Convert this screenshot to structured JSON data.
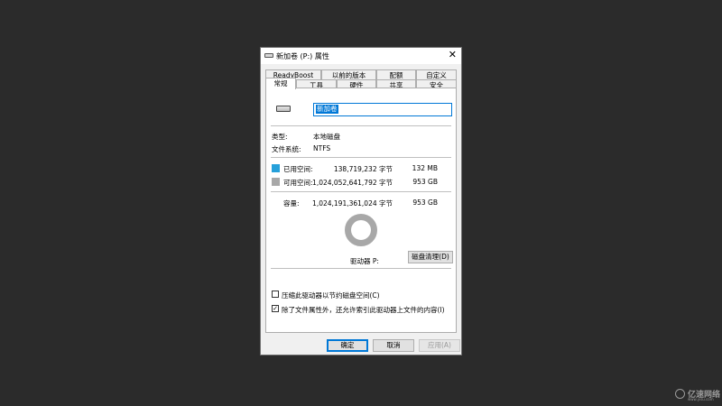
{
  "window": {
    "title": "新加卷 (P:) 属性",
    "close_glyph": "✕"
  },
  "tabs_row1": [
    "ReadyBoost",
    "以前的版本",
    "配额",
    "自定义"
  ],
  "tabs_row2": [
    "常规",
    "工具",
    "硬件",
    "共享",
    "安全"
  ],
  "active_tab": "常规",
  "general": {
    "volume_name": "新加卷",
    "type_label": "类型:",
    "type_value": "本地磁盘",
    "fs_label": "文件系统:",
    "fs_value": "NTFS",
    "used": {
      "label": "已用空间:",
      "bytes": "138,719,232 字节",
      "size": "132 MB",
      "color": "#26a0da"
    },
    "free": {
      "label": "可用空间:",
      "bytes": "1,024,052,641,792 字节",
      "size": "953 GB",
      "color": "#a8a8a8"
    },
    "capacity": {
      "label": "容量:",
      "bytes": "1,024,191,361,024 字节",
      "size": "953 GB"
    },
    "used_fraction": 0.000135,
    "drive_label": "驱动器 P:",
    "cleanup_button": "磁盘清理(D)",
    "compress_option": {
      "label": "压缩此驱动器以节约磁盘空间(C)",
      "checked": false
    },
    "index_option": {
      "label": "除了文件属性外，还允许索引此驱动器上文件的内容(I)",
      "checked": true,
      "check_glyph": "✓"
    }
  },
  "buttons": {
    "ok": "确定",
    "cancel": "取消",
    "apply": "应用(A)"
  },
  "watermark": {
    "text": "亿速网络",
    "sub": "www.yisu.com"
  }
}
